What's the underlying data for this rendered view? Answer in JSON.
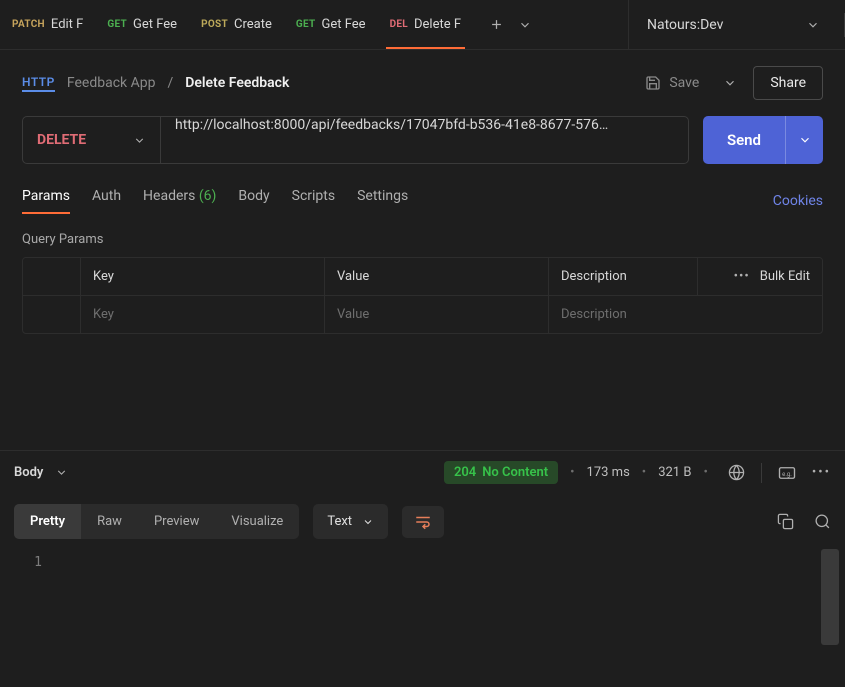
{
  "tabs": [
    {
      "method": "PATCH",
      "methodClass": "m-patch",
      "label": "Edit F"
    },
    {
      "method": "GET",
      "methodClass": "m-get",
      "label": "Get Fee"
    },
    {
      "method": "POST",
      "methodClass": "m-post",
      "label": "Create"
    },
    {
      "method": "GET",
      "methodClass": "m-get",
      "label": "Get Fee"
    },
    {
      "method": "DEL",
      "methodClass": "m-del",
      "label": "Delete F"
    }
  ],
  "environment": "Natours:Dev",
  "breadcrumb": {
    "collection": "Feedback App",
    "request": "Delete Feedback"
  },
  "actions": {
    "save": "Save",
    "share": "Share"
  },
  "request": {
    "method": "DELETE",
    "url": "http://localhost:8000/api/feedbacks/17047bfd-b536-41e8-8677-576…",
    "send": "Send"
  },
  "reqTabs": {
    "params": "Params",
    "auth": "Auth",
    "headers": "Headers",
    "headersCount": "(6)",
    "body": "Body",
    "scripts": "Scripts",
    "settings": "Settings",
    "cookies": "Cookies"
  },
  "querySection": {
    "title": "Query Params",
    "headers": {
      "key": "Key",
      "value": "Value",
      "description": "Description",
      "bulk": "Bulk Edit"
    },
    "placeholders": {
      "key": "Key",
      "value": "Value",
      "description": "Description"
    }
  },
  "response": {
    "label": "Body",
    "statusCode": "204",
    "statusText": "No Content",
    "time": "173 ms",
    "size": "321 B",
    "views": {
      "pretty": "Pretty",
      "raw": "Raw",
      "preview": "Preview",
      "visualize": "Visualize"
    },
    "contentType": "Text",
    "lineNumber": "1"
  }
}
